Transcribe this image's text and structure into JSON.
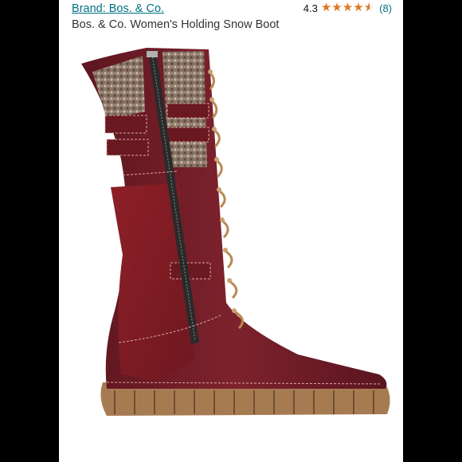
{
  "product": {
    "brand_link": "Brand: Bos. & Co.",
    "title": "Bos. & Co. Women's Holding Snow Boot",
    "rating_value": "4.3",
    "rating_count": "(8)",
    "stars": [
      {
        "icon": "star-full-icon"
      },
      {
        "icon": "star-full-icon"
      },
      {
        "icon": "star-full-icon"
      },
      {
        "icon": "star-full-icon"
      },
      {
        "icon": "star-half-icon"
      }
    ],
    "image_icon": "boot-product-image"
  },
  "colors": {
    "link": "#007185",
    "star": "#de7921",
    "boot_leather": "#7a1f2b",
    "boot_suede": "#8a1e24",
    "sole": "#a77b52"
  }
}
